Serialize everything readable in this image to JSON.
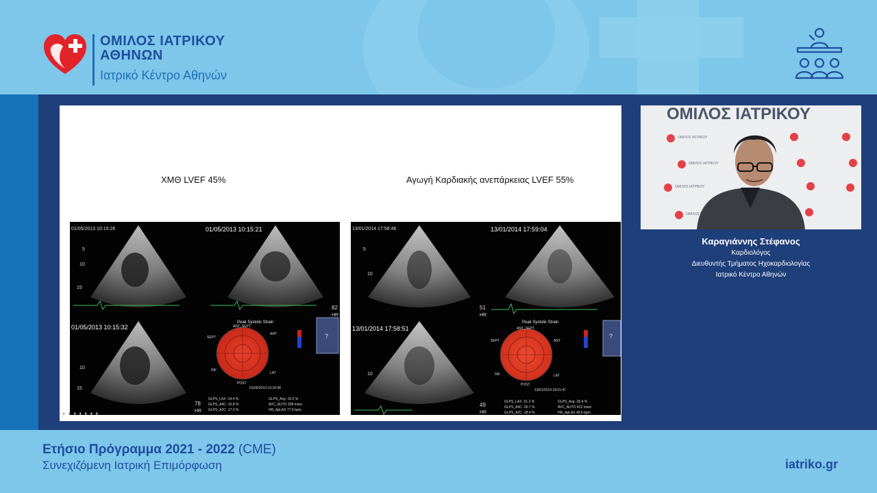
{
  "header": {
    "logo_line1": "ΟΜΙΛΟΣ ΙΑΤΡΙΚΟΥ",
    "logo_line2": "ΑΘΗΝΩΝ",
    "logo_line3": "Ιατρικό Κέντρο Αθηνών",
    "icon": "audience-podium-icon"
  },
  "slide": {
    "left_label": "ΧΜΘ LVEF 45%",
    "right_label": "Αγωγή Καρδιακής ανεπάρκειας LVEF 55%",
    "left_panel": {
      "timestamps": [
        "01/05/2013 10:15:26",
        "01/05/2013 10:15:21",
        "01/05/2013 10:15:32"
      ],
      "hr_values": [
        "82",
        "78"
      ],
      "hr_label": "HR",
      "strain_title": "Peak Systolic Strain",
      "seg_labels": [
        "ANT_SEPT",
        "ANT",
        "SEPT",
        "LAT",
        "INF",
        "POST"
      ],
      "footer_date": "01/05/2013 10:18:38",
      "stats": [
        "GLPS_LAX  -14.4 %",
        "GLPS_A4C  -15.8 %",
        "GLPS_A2C  -17.2 %",
        "GLPS_Avg  -15.5 %",
        "AVC_AUTO  308 msec",
        "HR_ApLAX  77.9 bpm"
      ]
    },
    "right_panel": {
      "timestamps": [
        "13/01/2014 17:58:46",
        "13/01/2014 17:59:04",
        "13/01/2014 17:58:51"
      ],
      "hr_values": [
        "51",
        "49"
      ],
      "hr_label": "HR",
      "strain_title": "Peak Systolic Strain",
      "seg_labels": [
        "ANT_SEPT",
        "ANT",
        "SEPT",
        "LAT",
        "INF",
        "POST"
      ],
      "footer_date": "13/01/2014 18:01:47",
      "stats": [
        "GLPS_LAX  -21.2 %",
        "GLPS_A4C  -26.7 %",
        "GLPS_A2C  -18.4 %",
        "GLPS_Avg  -25.4 %",
        "AVC_AUTO  422 msec",
        "HR_ApLAX  49.6 bpm"
      ]
    },
    "controls": "◐◐◐◐◐◐◐"
  },
  "speaker": {
    "name": "Καραγιάννης Στέφανος",
    "role1": "Καρδιολόγος",
    "role2": "Διευθυντής Τμήματος Ηχοκαρδιολογίας",
    "role3": "Ιατρικό Κέντρο Αθηνών",
    "backdrop_text": "ΟΜΙΛΟΣ ΙΑΤΡΙΚΟΥ"
  },
  "footer": {
    "title_bold": "Ετήσιο Πρόγραμμα 2021 - 2022",
    "title_suffix": " (CME)",
    "subtitle": "Συνεχιζόμενη Ιατρική Επιμόρφωση",
    "url": "iatriko.gr"
  },
  "colors": {
    "header_bg": "#7ec6ea",
    "main_bg": "#1f3f7a",
    "stripe": "#1672b8",
    "brand_text": "#1d4e9e",
    "logo_red": "#e2232a"
  }
}
